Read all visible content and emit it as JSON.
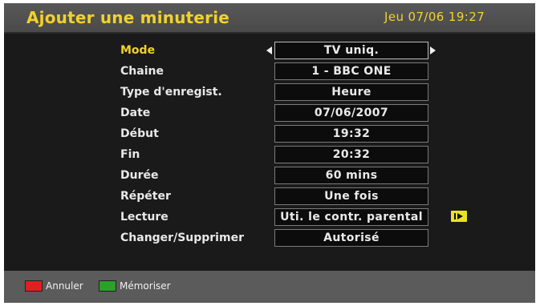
{
  "header": {
    "title": "Ajouter une minuterie",
    "clock": "Jeu 07/06 19:27"
  },
  "rows": [
    {
      "label": "Mode",
      "value": "TV uniq."
    },
    {
      "label": "Chaine",
      "value": "1 - BBC ONE"
    },
    {
      "label": "Type d'enregist.",
      "value": "Heure"
    },
    {
      "label": "Date",
      "value": "07/06/2007"
    },
    {
      "label": "Début",
      "value": "19:32"
    },
    {
      "label": "Fin",
      "value": "20:32"
    },
    {
      "label": "Durée",
      "value": "60 mins"
    },
    {
      "label": "Répéter",
      "value": "Une fois"
    },
    {
      "label": "Lecture",
      "value": "Uti. le contr. parental"
    },
    {
      "label": "Changer/Supprimer",
      "value": "Autorisé"
    }
  ],
  "footer": {
    "cancel_label": "Annuler",
    "cancel_color": "#e02020",
    "save_label": "Mémoriser",
    "save_color": "#2aa12a"
  },
  "icons": {
    "mode_left": "arrow-left-icon",
    "mode_right": "arrow-right-icon",
    "lecture_action": "play-icon"
  },
  "colors": {
    "title": "#f2d22a",
    "selected_label": "#f2d22a",
    "label": "#e8e8e8"
  }
}
